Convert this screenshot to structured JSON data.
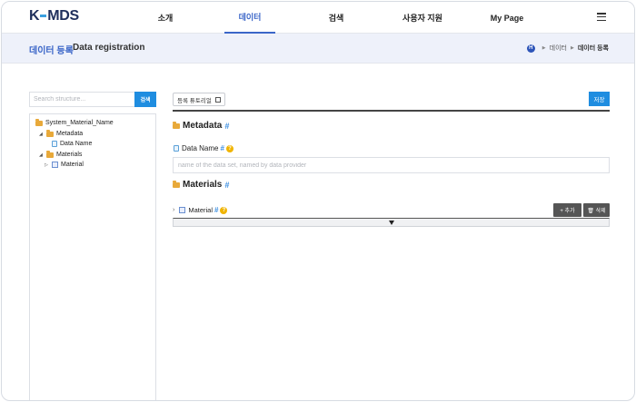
{
  "header": {
    "logo_left": "K",
    "logo_right": "MDS",
    "nav": [
      {
        "label": "소개"
      },
      {
        "label": "데이터"
      },
      {
        "label": "검색"
      },
      {
        "label": "사용자 지원"
      },
      {
        "label": "My Page"
      }
    ],
    "active_nav": "데이터",
    "menu_icon": "hamburger-menu-icon"
  },
  "title_band": {
    "title_kr": "데이터 등록",
    "title_en": "Data registration",
    "breadcrumb": {
      "home_letter": "H",
      "items": [
        "데이터",
        "데이터 등록"
      ]
    }
  },
  "sidebar": {
    "search_placeholder": "Search structure...",
    "search_button": "검색",
    "tree": {
      "root": "System_Material_Name",
      "metadata": "Metadata",
      "data_name": "Data Name",
      "materials": "Materials",
      "material": "Material"
    }
  },
  "main": {
    "tutorial_button": "등록 튜토리얼",
    "save_button": "저장",
    "metadata_section": {
      "title": "Metadata",
      "hash": "#"
    },
    "data_name_field": {
      "label": "Data Name",
      "hash": "#",
      "help": "?",
      "placeholder": "name of the data set, named by data provider",
      "value": ""
    },
    "materials_section": {
      "title": "Materials",
      "hash": "#"
    },
    "material_row": {
      "label": "Material",
      "hash": "#",
      "help": "?",
      "add_button": "+ 추가",
      "delete_button": "🗑 삭제"
    }
  },
  "colors": {
    "brand_navy": "#1f2f5c",
    "accent_blue": "#3b66c8",
    "button_blue": "#1f8de0",
    "title_band_bg": "#eef1fa",
    "folder_orange": "#e8a93a",
    "help_yellow": "#f0b400",
    "dark_button": "#555555"
  }
}
